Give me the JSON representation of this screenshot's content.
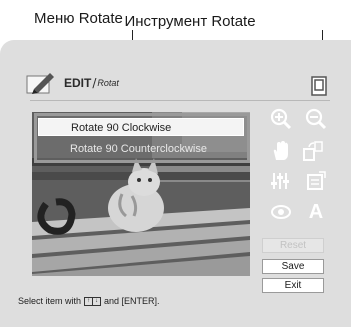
{
  "callouts": {
    "menu": "Меню Rotate",
    "tool": "Инструмент Rotate"
  },
  "header": {
    "title": "EDIT",
    "subtitle": "Rotat"
  },
  "menu": {
    "items": [
      {
        "label": "Rotate 90 Clockwise",
        "selected": true
      },
      {
        "label": "Rotate 90 Counterclockwise",
        "selected": false
      }
    ]
  },
  "tools": [
    {
      "icon": "zoom-in-icon"
    },
    {
      "icon": "zoom-out-icon"
    },
    {
      "icon": "hand-icon"
    },
    {
      "icon": "rotate-icon"
    },
    {
      "icon": "adjust-icon"
    },
    {
      "icon": "filter-icon"
    },
    {
      "icon": "red-eye-icon"
    },
    {
      "icon": "text-icon",
      "glyph": "A"
    }
  ],
  "buttons": {
    "reset": "Reset",
    "save": "Save",
    "exit": "Exit"
  },
  "status": {
    "prefix": "Select item with",
    "key_up": "↑",
    "key_down": "↓",
    "suffix": "and [ENTER]."
  }
}
